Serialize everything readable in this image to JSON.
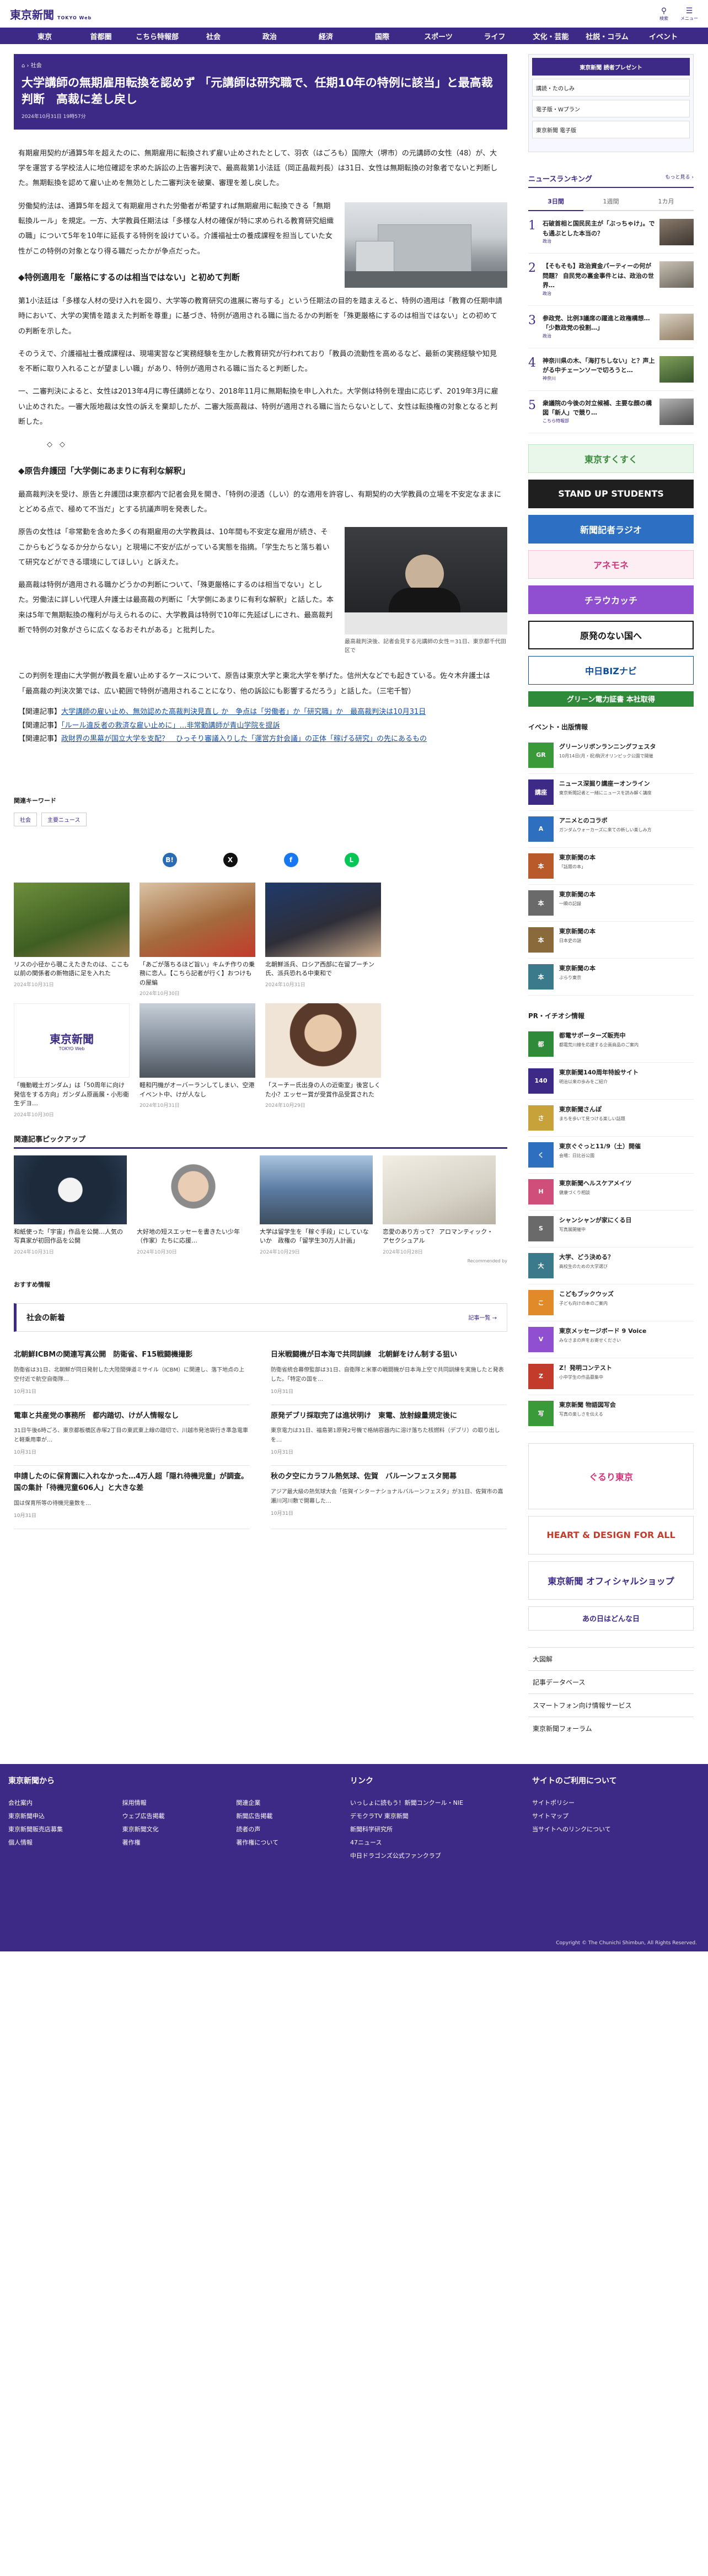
{
  "header": {
    "logo": "東京新聞",
    "logo_sub": "TOKYO Web",
    "icons": [
      {
        "icon": "search-icon",
        "label": "検索"
      },
      {
        "icon": "menu-icon",
        "label": "メニュー"
      }
    ],
    "nav": [
      "東京",
      "首都圏",
      "こちら特報部",
      "社会",
      "政治",
      "経済",
      "国際",
      "スポーツ",
      "ライフ",
      "文化・芸能",
      "社説・コラム",
      "イベント"
    ]
  },
  "article": {
    "breadcrumb": [
      "社会"
    ],
    "title": "大学講師の無期雇用転換を認めず 「元講師は研究職で、任期10年の特例に該当」と最高裁判断　高裁に差し戻し",
    "date": "2024年10月31日 19時57分",
    "lead": "有期雇用契約が通算5年を超えたのに、無期雇用に転換されず雇い止めされたとして、羽衣（はごろも）国際大（堺市）の元講師の女性（48）が、大学を運営する学校法人に地位確認を求めた訴訟の上告審判決で、最高裁第1小法廷（岡正晶裁判長）は31日、女性は無期転換の対象者でないと判断した。無期転換を認めて雇い止めを無効とした二審判決を破棄、審理を差し戻した。",
    "p1": "労働契約法は、通算5年を超えて有期雇用された労働者が希望すれば無期雇用に転換できる「無期転換ルール」を規定。一方、大学教員任期法は「多様な人材の確保が特に求められる教育研究組織の職」について5年を10年に延長する特例を設けている。介護福祉士の養成課程を担当していた女性がこの特例の対象となり得る職だったかが争点だった。",
    "sub1": "◆特例適用を「厳格にするのは相当ではない」と初めて判断",
    "p2": "第1小法廷は「多様な人材の受け入れを図り、大学等の教育研究の進展に寄与する」という任期法の目的を踏まえると、特例の適用は「教育の任期申請時において、大学の実情を踏まえた判断を尊重」に基づき、特例が適用される職に当たるかの判断を「殊更厳格にするのは相当ではない」との初めての判断を示した。",
    "p3": "そのうえで、介護福祉士養成課程は、現場実習など実務経験を生かした教育研究が行われており「教員の流動性を高めるなど、最新の実務経験や知見を不断に取り入れることが望ましい職」があり、特例が適用される職に当たると判断した。",
    "p4": "一、二審判決によると、女性は2013年4月に専任講師となり、2018年11月に無期転換を申し入れた。大学側は特例を理由に応じず、2019年3月に雇い止めされた。一審大阪地裁は女性の訴えを棄却したが、二審大阪高裁は、特例が適用される職に当たらないとして、女性は転換権の対象となると判断した。",
    "sep": "◇　◇",
    "sub2": "◆原告弁護団「大学側にあまりに有利な解釈」",
    "p5": "最高裁判決を受け、原告と弁護団は東京都内で記者会見を開き、「特例の浸透（しい）的な適用を許容し、有期契約の大学教員の立場を不安定なままにとどめる点で、極めて不当だ」とする抗議声明を発表した。",
    "p6": "原告の女性は「非常勤を含めた多くの有期雇用の大学教員は、10年間も不安定な雇用が続き、そこからもどうなるか分からない」と現場に不安が広がっている実態を指摘。「学生たちと落ち着いて研究などができる環境にしてほしい」と訴えた。",
    "p7": "最高裁は特例が適用される職かどうかの判断について、「殊更厳格にするのは相当でない」とした。労働法に詳しい代理人弁護士は最高裁の判断に「大学側にあまりに有利な解釈」と話した。本来は5年で無期転換の権利が与えられるのに、大学教員は特例で10年に先延ばしにされ、最高裁判断で特例の対象がさらに広くなるおそれがある」と批判した。",
    "p8": "この判例を理由に大学側が教員を雇い止めするケースについて、原告は東京大学と東北大学を挙げた。信州大などでも起きている。佐々木弁護士は「最高裁の判決次第では、広い範囲で特例が適用されることになり、他の訴訟にも影響するだろう」と話した。（三宅千智）",
    "photo_caption": "最高裁判決後、記者会見する元講師の女性＝31日、東京都千代田区で",
    "related": [
      {
        "label": "【関連記事】",
        "text": "大学講師の雇い止め、無効認めた高裁判決見直し か　争点は「労働者」か「研究職」か　最高裁判決は10月31日"
      },
      {
        "label": "【関連記事】",
        "text": "「ルール違反者の救済な雇い止めに」…非常勤講師が青山学院を提訴"
      },
      {
        "label": "【関連記事】",
        "text": "政財界の黒幕が国立大学を支配？　ひっそり審議入りした「運営方針会議」の正体「稼げる研究」の先にあるもの"
      }
    ],
    "keywords_title": "関連キーワード",
    "keywords": [
      "社会",
      "主要ニュース"
    ],
    "share": [
      {
        "icon": "x-icon",
        "label": "X"
      },
      {
        "icon": "facebook-icon",
        "label": "f"
      },
      {
        "icon": "line-icon",
        "label": "L"
      },
      {
        "icon": "hatena-icon",
        "label": "B!"
      }
    ]
  },
  "recommend": {
    "cards": [
      {
        "title": "リスの小径から覗こえたきたのは、ここも以前の関係者の新物語に足を入れた",
        "date": "2024年10月31日"
      },
      {
        "title": "「あごが落ちるほど旨い」キムチ作りの乗務に恋人。【こちら記者が行く】おつけもの屋編",
        "date": "2024年10月30日"
      },
      {
        "title": "北朝鮮派兵、ロシア西部に在留プーチン氏、派兵恐れる中東和で",
        "date": "2024年10月31日"
      },
      {
        "title": "「機動戦士ガンダム」は「50周年に向け発信をする方向」ガンダム原画展・小形衛生デヨ…",
        "date": "2024年10月30日"
      },
      {
        "title": "軽和円機がオーバーランしてしまい、空港イベント中、けが人なし",
        "date": "2024年10月31日"
      },
      {
        "title": "「スーチー氏出身の人の近衛室」後宮しくた小？エッセー賞が受賞作品受賞された",
        "date": "2024年10月29日"
      }
    ],
    "tokyoweb_logo": "東京新聞",
    "tokyoweb_sub": "TOKYO Web"
  },
  "pickup": {
    "title": "関連記事ピックアップ",
    "cards": [
      {
        "title": "和紙使った「宇宙」作品を公開…人気の写真家が初回作品を公開",
        "date": "2024年10月31日"
      },
      {
        "title": "大好地の短スエッセーを書きたい少年（作家）たちに応援…",
        "date": "2024年10月30日"
      },
      {
        "title": "大学は留学生を「稼ぐ手段」にしていないか　政権の「留学生30万人計画」",
        "date": "2024年10月29日"
      },
      {
        "title": "恋愛のあり方って？ アロマンティック・アセクシュアル",
        "date": "2024年10月28日"
      }
    ],
    "recommended_by": "Recommended by",
    "osusume": "おすすめ情報"
  },
  "shakai": {
    "title": "社会の新着",
    "more": "記事一覧 →",
    "items": [
      {
        "head": "北朝鮮ICBMの関連写真公開　防衛省、F15戦闘機撮影",
        "body": "防衛省は31日、北朝鮮が同日発射した大陸間弾道ミサイル（ICBM）に関連し、落下地点の上空付近で航空自衛隊…",
        "date": "10月31日"
      },
      {
        "head": "日米戦闘機が日本海で共同訓練　北朝鮮をけん制する狙い",
        "body": "防衛省統合幕僚監部は31日、自衛隊と米軍の戦闘機が日本海上空で共同訓練を実施したと発表した。「特定の国を…",
        "date": "10月31日"
      },
      {
        "head": "電車と共産党の事務所　都内踏切、けが人情報なし",
        "body": "31日午後6時ごろ、東京都板橋区赤塚2丁目の東武東上線の踏切で、川越市発池袋行き準急電車と軽乗用車が…",
        "date": "10月31日"
      },
      {
        "head": "原発デブリ採取完了は進状明け　東電、放射線量規定後に",
        "body": "東京電力は31日、福島第1原発2号機で格納容器内に溶け落ちた核燃料（デブリ）の取り出しを…",
        "date": "10月31日"
      },
      {
        "head": "申請したのに保育園に入れなかった…4万人超「隠れ待機児童」が調査。国の集計「待機児童606人」と大きな差",
        "body": "国は保育所等の待機児童数を…",
        "date": "10月31日"
      },
      {
        "head": "秋の夕空にカラフル熱気球、佐賀　バルーンフェスタ開幕",
        "body": "アジア最大級の熱気球大会「佐賀インターナショナルバルーンフェスタ」が31日、佐賀市の嘉瀬川河川敷で開幕した…",
        "date": "10月31日"
      }
    ]
  },
  "sidebar": {
    "ad": [
      "東京新聞 読者プレゼント",
      "講読・たのしみ",
      "電子版・Wプラン",
      "東京新聞 電子版"
    ],
    "ranking_title": "ニュースランキング",
    "ranking_more": "もっと見る ›",
    "tabs": [
      "3日間",
      "1週間",
      "1カ月"
    ],
    "ranking": [
      {
        "text": "石破首相と国民民主が「ぶっちゃけ」。でも通ぶとした本当の？",
        "cat": "政治"
      },
      {
        "text": "【そもそも】政治資金パーティーの何が問題？ 自民党の裏金事件とは、政治の世界…",
        "cat": "政治"
      },
      {
        "text": "参政党、比例3議席の躍進と政権構想…「少数政党の役割…」",
        "cat": "政治"
      },
      {
        "text": "神奈川県の木、「海打ちしない」と？声上がる中チェーンソーで切ろうと…",
        "cat": "神奈川"
      },
      {
        "text": "衆議院の今後の対立候補、主要な顔の構図「新人」で競り…",
        "cat": "こちら特報部"
      }
    ],
    "banners": [
      "東京すくすく",
      "STAND UP STUDENTS",
      "新聞記者ラジオ",
      "アネモネ",
      "チラウカッチ",
      "原発のない国へ",
      "中日BIZナビ",
      "グリーン電力証書 本社取得"
    ],
    "events_title": "イベント・出版情報",
    "events": [
      {
        "title": "グリーンリボンランニングフェスタ",
        "body": "10月14日(月・祝)駒沢オリンピック公園で開催",
        "icon": "GR"
      },
      {
        "title": "ニュース深掘り講座ーオンライン",
        "body": "東京新聞記者と一緒にニュースを読み解く講座",
        "icon": "講座"
      },
      {
        "title": "アニメとのコラボ",
        "body": "ガンダムウォーカーズに来ての新しい楽しみ方",
        "icon": "A"
      },
      {
        "title": "東京新聞の本",
        "body": "「話題の本」",
        "icon": "本"
      },
      {
        "title": "東京新聞の本",
        "body": "一瞬の記録",
        "icon": "本"
      },
      {
        "title": "東京新聞の本",
        "body": "日本史の謎",
        "icon": "本"
      },
      {
        "title": "東京新聞の本",
        "body": "ぶらり東京",
        "icon": "本"
      }
    ],
    "pr_title": "PR・イチオシ情報",
    "pr": [
      {
        "title": "都電サポーターズ販売中",
        "body": "都電荒川線を応援する企画商品のご案内",
        "icon": "都"
      },
      {
        "title": "東京新聞140周年特設サイト",
        "body": "明治以来の歩みをご紹介",
        "icon": "140"
      },
      {
        "title": "東京新聞さんぽ",
        "body": "まちを歩いて見つける楽しい話題",
        "icon": "さ"
      },
      {
        "title": "東京ぐぐっと11/9（土）開催",
        "body": "会場：日比谷公園",
        "icon": "く"
      },
      {
        "title": "東京新聞ヘルスケアメイツ",
        "body": "健康づくり相談",
        "icon": "H"
      },
      {
        "title": "シャンシャンが家にくる日",
        "body": "写真展開催中",
        "icon": "S"
      },
      {
        "title": "大学、どう決める？",
        "body": "高校生のための大学選び",
        "icon": "大"
      },
      {
        "title": "こどもブックウッズ",
        "body": "子ども向けの本のご案内",
        "icon": "こ"
      },
      {
        "title": "東京メッセージボード 9 Voice",
        "body": "みなさまの声をお寄せください",
        "icon": "V"
      },
      {
        "title": "Z！発明コンテスト",
        "body": "小中学生の作品募集中",
        "icon": "Z"
      },
      {
        "title": "東京新聞 物語図写会",
        "body": "写真の楽しさを伝える",
        "icon": "写"
      }
    ],
    "links": [
      "大図解",
      "記事データベース",
      "スマートフォン向け情報サービス",
      "東京新聞フォーラム"
    ]
  },
  "footer": {
    "col1_title": "東京新聞から",
    "col1": [
      "会社案内",
      "採用情報",
      "関連企業",
      "東京新聞申込",
      "ウェブ広告掲載",
      "新聞広告掲載",
      "東京新聞販売店募集",
      "東京新聞文化",
      "読者の声",
      "個人情報",
      "著作権",
      "著作権について"
    ],
    "col2_title": "リンク",
    "col2": [
      "いっしょに読もう！新聞コンクール・NIE",
      "デモクラTV 東京新聞",
      "新聞科学研究所",
      "47ニュース",
      "中日ドラゴンズ公式ファンクラブ"
    ],
    "col3_title": "サイトのご利用について",
    "col3": [
      "サイトポリシー",
      "サイトマップ",
      "当サイトへのリンクについて"
    ],
    "copyright": "Copyright © The Chunichi Shimbun, All Rights Reserved."
  }
}
